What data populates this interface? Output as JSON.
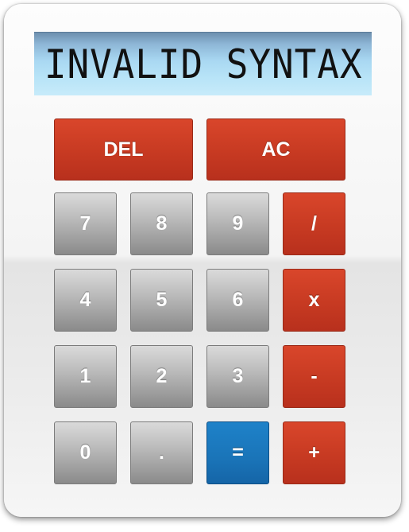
{
  "display": {
    "text": "INVALID SYNTAX"
  },
  "buttons": {
    "del": "DEL",
    "ac": "AC",
    "seven": "7",
    "eight": "8",
    "nine": "9",
    "divide": "/",
    "four": "4",
    "five": "5",
    "six": "6",
    "multiply": "x",
    "one": "1",
    "two": "2",
    "three": "3",
    "subtract": "-",
    "zero": "0",
    "decimal": ".",
    "equals": "=",
    "add": "+"
  },
  "colors": {
    "operator_red": "#c73a22",
    "digit_grey": "#b0b0b0",
    "equals_blue": "#1a74b8",
    "display_blue": "#a9d8f2"
  }
}
